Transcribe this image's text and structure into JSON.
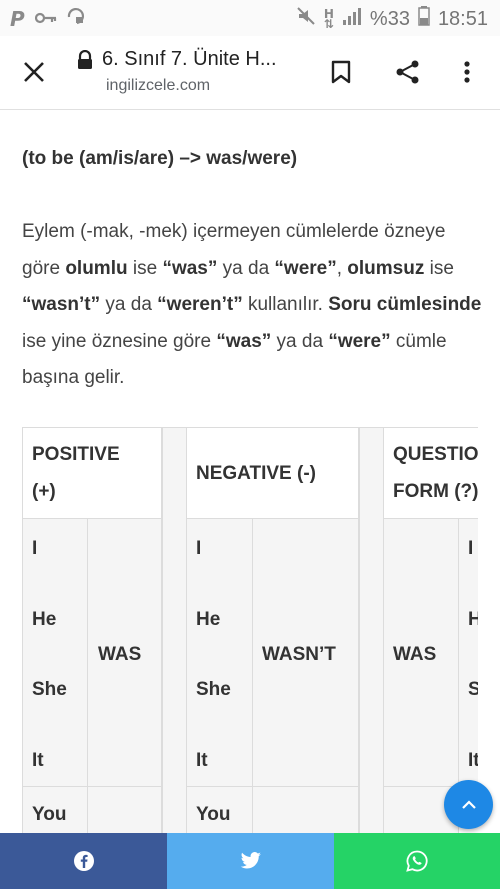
{
  "status_bar": {
    "left_icons": [
      "p-notification-icon",
      "key-icon",
      "vpn-icon"
    ],
    "battery": "%33",
    "time": "18:51"
  },
  "header": {
    "title": "6. Sınıf 7. Ünite H...",
    "url": "ingilizcele.com"
  },
  "article": {
    "heading": "(to be (am/is/are) –> was/were)",
    "paragraph": [
      {
        "t": "Eylem (-mak, -mek) içermeyen cümlelerde özneye göre ",
        "b": false
      },
      {
        "t": "olumlu",
        "b": true
      },
      {
        "t": " ise ",
        "b": false
      },
      {
        "t": "“was”",
        "b": true
      },
      {
        "t": " ya da ",
        "b": false
      },
      {
        "t": "“were”",
        "b": true
      },
      {
        "t": ", ",
        "b": false
      },
      {
        "t": "olumsuz",
        "b": true
      },
      {
        "t": " ise ",
        "b": false
      },
      {
        "t": "“wasn’t”",
        "b": true
      },
      {
        "t": " ya da ",
        "b": false
      },
      {
        "t": "“weren’t”",
        "b": true
      },
      {
        "t": " kullanılır. ",
        "b": false
      },
      {
        "t": "Soru cümlesinde",
        "b": true
      },
      {
        "t": " ise yine öznesine göre ",
        "b": false
      },
      {
        "t": "“was”",
        "b": true
      },
      {
        "t": " ya da ",
        "b": false
      },
      {
        "t": "“were”",
        "b": true
      },
      {
        "t": " cümle başına gelir.",
        "b": false
      }
    ]
  },
  "table": {
    "positive_header": [
      "POSITIVE",
      "(+)"
    ],
    "negative_header": "NEGATIVE (-)",
    "question_header": [
      "QUESTIO",
      "FORM (?)"
    ],
    "subjects": [
      "I",
      "He",
      "She",
      "It"
    ],
    "subject_you": "You",
    "positive_verb": "WAS",
    "negative_verb": "WASN’T",
    "question_verb": "WAS",
    "question_subjects_partial": [
      "I",
      "H",
      "S",
      "It"
    ]
  },
  "share": {
    "facebook_color": "#3b5998",
    "twitter_color": "#55acee",
    "whatsapp_color": "#25d366"
  },
  "colors": {
    "fab": "#1e88e5"
  }
}
